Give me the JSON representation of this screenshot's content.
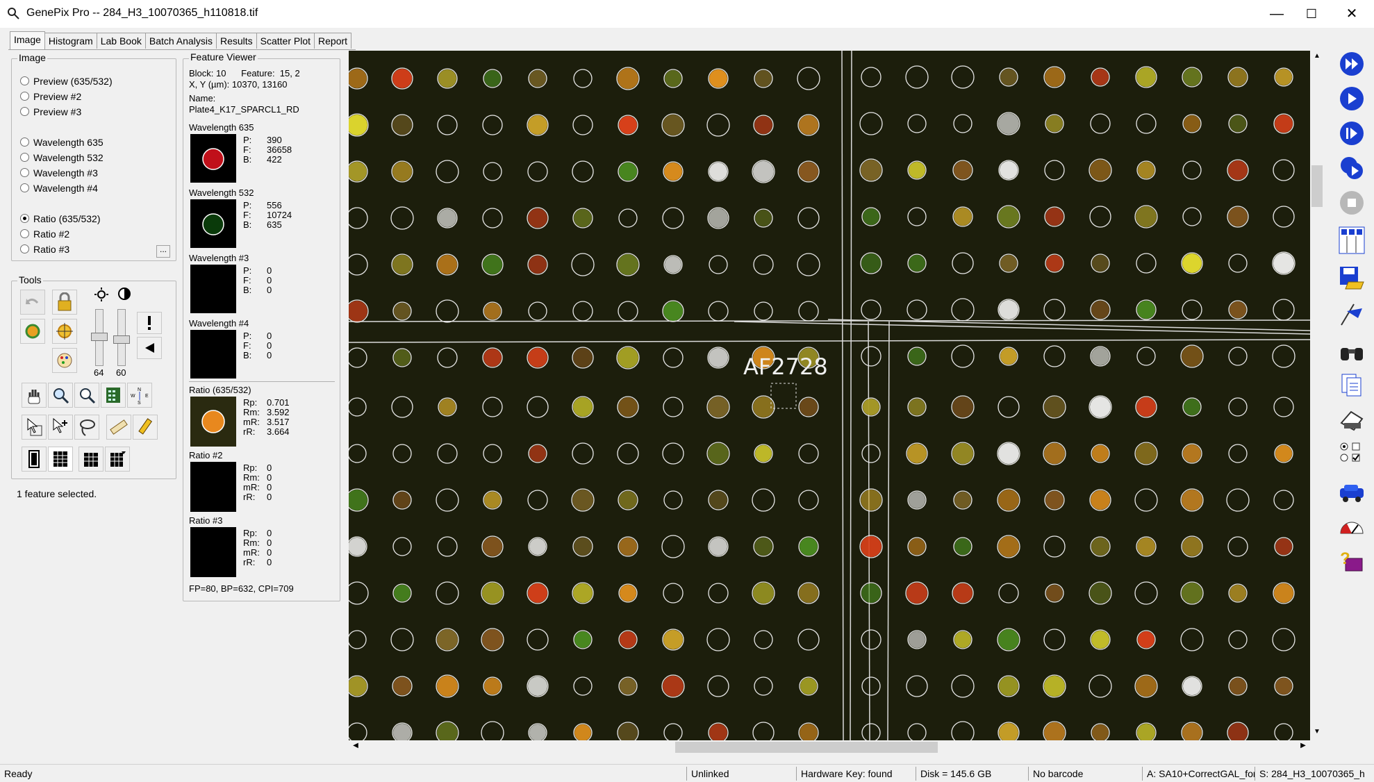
{
  "window": {
    "title": "GenePix Pro -- 284_H3_10070365_h110818.tif",
    "minimize": "—",
    "maximize": "☐",
    "close": "✕"
  },
  "tabs": [
    "Image",
    "Histogram",
    "Lab Book",
    "Batch Analysis",
    "Results",
    "Scatter Plot",
    "Report"
  ],
  "image_group": {
    "label": "Image",
    "options": [
      {
        "label": "Preview (635/532)",
        "selected": false
      },
      {
        "label": "Preview #2",
        "selected": false
      },
      {
        "label": "Preview #3",
        "selected": false
      },
      {
        "label": "Wavelength 635",
        "selected": false
      },
      {
        "label": "Wavelength 532",
        "selected": false
      },
      {
        "label": "Wavelength #3",
        "selected": false
      },
      {
        "label": "Wavelength #4",
        "selected": false
      },
      {
        "label": "Ratio (635/532)",
        "selected": true
      },
      {
        "label": "Ratio #2",
        "selected": false
      },
      {
        "label": "Ratio #3",
        "selected": false
      }
    ],
    "more_button": "..."
  },
  "tools": {
    "label": "Tools",
    "brightness_value": "64",
    "contrast_value": "60",
    "selection_status": "1 feature selected."
  },
  "feature_viewer": {
    "label": "Feature Viewer",
    "block_line": "Block: 10      Feature:  15, 2",
    "xy_line": "X, Y (µm): 10370, 13160",
    "name_label": "Name:",
    "name_value": "Plate4_K17_SPARCL1_RD",
    "channels": [
      {
        "title": "Wavelength 635",
        "P": "390",
        "F": "36658",
        "B": "422",
        "thumb_color": "#c0101a"
      },
      {
        "title": "Wavelength 532",
        "P": "556",
        "F": "10724",
        "B": "635",
        "thumb_color": "#0a3a0a"
      },
      {
        "title": "Wavelength #3",
        "P": "0",
        "F": "0",
        "B": "0",
        "thumb_color": "#000000"
      },
      {
        "title": "Wavelength #4",
        "P": "0",
        "F": "0",
        "B": "0",
        "thumb_color": "#000000"
      }
    ],
    "ratios": [
      {
        "title": "Ratio (635/532)",
        "Rp": "0.701",
        "Rm": "3.592",
        "mR": "3.517",
        "rR": "3.664",
        "thumb_color": "#e8881e"
      },
      {
        "title": "Ratio #2",
        "Rp": "0",
        "Rm": "0",
        "mR": "0",
        "rR": "0",
        "thumb_color": "#000000"
      },
      {
        "title": "Ratio #3",
        "Rp": "0",
        "Rm": "0",
        "mR": "0",
        "rR": "0",
        "thumb_color": "#000000"
      }
    ],
    "footer": "FP=80, BP=632, CPI=709"
  },
  "image_view": {
    "annotation": "AF2728"
  },
  "status_bar": {
    "ready": "Ready",
    "link": "Unlinked",
    "hardware_key": "Hardware Key: found",
    "disk": "Disk = 145.6 GB",
    "barcode": "No barcode",
    "settings": "A: SA10+CorrectGAL_for",
    "scan": "S: 284_H3_10070365_h"
  },
  "colors": {
    "spot_red": "#d8401a",
    "spot_orange": "#e0901e",
    "spot_yellow": "#c8c030",
    "spot_green": "#4a8a20",
    "background": "#1c1e0c",
    "accent_blue": "#1a3fd0"
  }
}
